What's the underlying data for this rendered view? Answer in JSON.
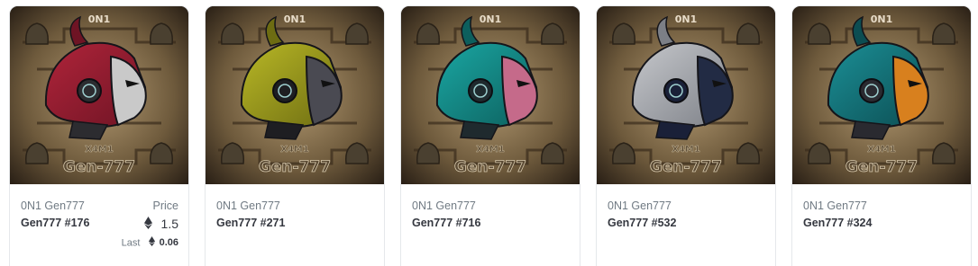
{
  "cards": [
    {
      "collection": "0N1 Gen777",
      "name": "Gen777 #176",
      "price_label": "Price",
      "price": "1.5",
      "last_label": "Last",
      "last": "0.06",
      "art": {
        "helmet": "#b0243a",
        "helmet_dark": "#6e1424",
        "face": "#c9c9c9",
        "accent": "#2c2c30"
      },
      "watermark": {
        "top": "0N1",
        "mid": "X4M1",
        "bottom": "Gen-777"
      }
    },
    {
      "collection": "0N1 Gen777",
      "name": "Gen777 #271",
      "art": {
        "helmet": "#b9b826",
        "helmet_dark": "#6d6c12",
        "face": "#4a4a52",
        "accent": "#1e1e22"
      },
      "watermark": {
        "top": "0N1",
        "mid": "X4M1",
        "bottom": "Gen-777"
      }
    },
    {
      "collection": "0N1 Gen777",
      "name": "Gen777 #716",
      "art": {
        "helmet": "#1aa7a3",
        "helmet_dark": "#0d5f5d",
        "face": "#c56a8a",
        "accent": "#1f2a2e"
      },
      "watermark": {
        "top": "0N1",
        "mid": "X4M1",
        "bottom": "Gen-777"
      }
    },
    {
      "collection": "0N1 Gen777",
      "name": "Gen777 #532",
      "art": {
        "helmet": "#c6c8cc",
        "helmet_dark": "#7c7f86",
        "face": "#222b44",
        "accent": "#1a2038"
      },
      "watermark": {
        "top": "0N1",
        "mid": "X4M1",
        "bottom": "Gen-777"
      }
    },
    {
      "collection": "0N1 Gen777",
      "name": "Gen777 #324",
      "art": {
        "helmet": "#1b8f96",
        "helmet_dark": "#0c4d52",
        "face": "#d8801e",
        "accent": "#2a2a30"
      },
      "watermark": {
        "top": "0N1",
        "mid": "X4M1",
        "bottom": "Gen-777"
      }
    }
  ]
}
